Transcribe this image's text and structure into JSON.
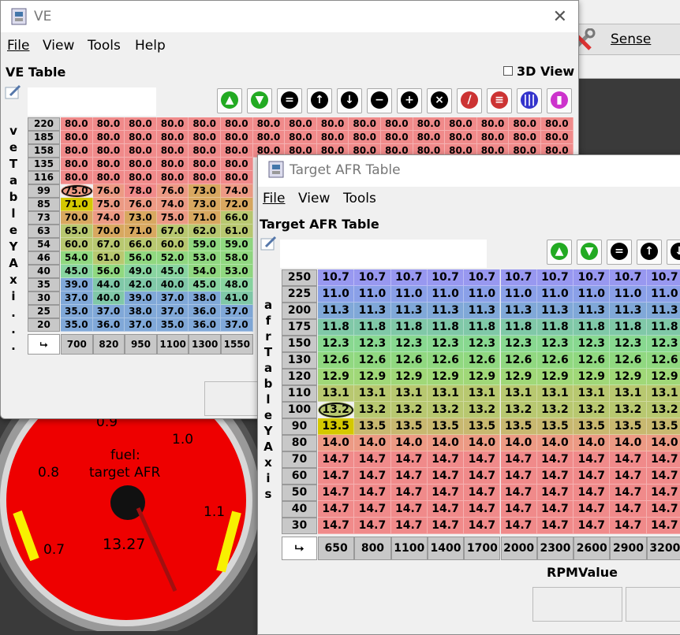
{
  "bg_window": {
    "sensor_label": "Sense"
  },
  "gauge": {
    "title_line1": "fuel:",
    "title_line2": "target AFR",
    "value": "13.27",
    "ticks": [
      "0.7",
      "0.8",
      "0.9",
      "1.0",
      "1.1"
    ]
  },
  "ve_window": {
    "title": "VE",
    "menu": [
      "File",
      "View",
      "Tools",
      "Help"
    ],
    "panel_title": "VE Table",
    "view3d_label": "3D View",
    "y_axis_label": "veTableYAxi...",
    "y_values": [
      "220",
      "185",
      "158",
      "135",
      "116",
      "99",
      "85",
      "73",
      "63",
      "54",
      "46",
      "40",
      "35",
      "30",
      "25",
      "20"
    ],
    "x_values": [
      "700",
      "820",
      "950",
      "1100",
      "1300",
      "1550"
    ],
    "rows": [
      [
        "80.0",
        "80.0",
        "80.0",
        "80.0",
        "80.0",
        "80.0",
        "80.0",
        "80.0",
        "80.0",
        "80.0",
        "80.0",
        "80.0",
        "80.0",
        "80.0",
        "80.0",
        "80.0"
      ],
      [
        "80.0",
        "80.0",
        "80.0",
        "80.0",
        "80.0",
        "80.0",
        "80.0",
        "80.0",
        "80.0",
        "80.0",
        "80.0",
        "80.0",
        "80.0",
        "80.0",
        "80.0",
        "80.0"
      ],
      [
        "80.0",
        "80.0",
        "80.0",
        "80.0",
        "80.0",
        "80.0",
        "80.0",
        "80.0",
        "80.0",
        "80.0",
        "80.0",
        "80.0",
        "80.0",
        "80.0",
        "80.0",
        "80.0"
      ],
      [
        "80.0",
        "80.0",
        "80.0",
        "80.0",
        "80.0",
        "80.0"
      ],
      [
        "80.0",
        "80.0",
        "80.0",
        "80.0",
        "80.0",
        "80.0"
      ],
      [
        "75.0",
        "76.0",
        "78.0",
        "76.0",
        "73.0",
        "74.0"
      ],
      [
        "71.0",
        "75.0",
        "76.0",
        "74.0",
        "73.0",
        "72.0"
      ],
      [
        "70.0",
        "74.0",
        "73.0",
        "75.0",
        "71.0",
        "66.0"
      ],
      [
        "65.0",
        "70.0",
        "71.0",
        "67.0",
        "62.0",
        "61.0"
      ],
      [
        "60.0",
        "67.0",
        "66.0",
        "60.0",
        "59.0",
        "59.0"
      ],
      [
        "54.0",
        "61.0",
        "56.0",
        "52.0",
        "53.0",
        "58.0"
      ],
      [
        "45.0",
        "56.0",
        "49.0",
        "45.0",
        "54.0",
        "53.0"
      ],
      [
        "39.0",
        "44.0",
        "42.0",
        "40.0",
        "45.0",
        "48.0"
      ],
      [
        "37.0",
        "40.0",
        "39.0",
        "37.0",
        "38.0",
        "41.0"
      ],
      [
        "35.0",
        "37.0",
        "38.0",
        "37.0",
        "36.0",
        "37.0"
      ],
      [
        "35.0",
        "36.0",
        "37.0",
        "35.0",
        "36.0",
        "37.0"
      ]
    ]
  },
  "afr_window": {
    "title": "Target AFR Table",
    "menu": [
      "File",
      "View",
      "Tools"
    ],
    "panel_title": "Target AFR Table",
    "y_axis_label": "afrTableYAxis",
    "x_axis_title": "RPMValue",
    "y_values": [
      "250",
      "225",
      "200",
      "175",
      "150",
      "130",
      "120",
      "110",
      "100",
      "90",
      "80",
      "70",
      "60",
      "50",
      "40",
      "30"
    ],
    "x_values": [
      "650",
      "800",
      "1100",
      "1400",
      "1700",
      "2000",
      "2300",
      "2600",
      "2900",
      "3200"
    ],
    "row_values": [
      "10.7",
      "11.0",
      "11.3",
      "11.8",
      "12.3",
      "12.6",
      "12.9",
      "13.1",
      "13.2",
      "13.5",
      "14.0",
      "14.7",
      "14.7",
      "14.7",
      "14.7",
      "14.7"
    ]
  },
  "colors": {
    "red": "#f08a8a",
    "salmon": "#ec9a84",
    "orange": "#d8a860",
    "yellowgreen": "#b8c870",
    "green": "#90d880",
    "teal": "#80c8a8",
    "blue": "#80a8d8",
    "violet": "#9898f0",
    "highlight": "#d4c800"
  }
}
